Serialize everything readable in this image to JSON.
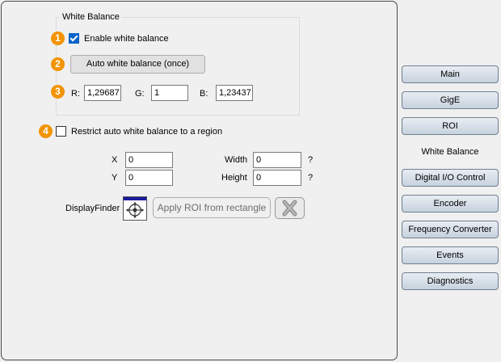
{
  "group": {
    "title": "White Balance"
  },
  "markers": [
    "1",
    "2",
    "3",
    "4"
  ],
  "enable_wb": {
    "label": "Enable white balance",
    "checked": true
  },
  "auto_wb": {
    "label": "Auto white balance (once)"
  },
  "rgb": {
    "r_label": "R:",
    "r_value": "1,29687",
    "g_label": "G:",
    "g_value": "1",
    "b_label": "B:",
    "b_value": "1,23437"
  },
  "restrict": {
    "label": "Restrict auto white balance to a region",
    "checked": false
  },
  "roi": {
    "x_label": "X",
    "x_value": "0",
    "y_label": "Y",
    "y_value": "0",
    "width_label": "Width",
    "width_value": "0",
    "width_help": "?",
    "height_label": "Height",
    "height_value": "0",
    "height_help": "?"
  },
  "display_finder": {
    "label": "DisplayFinder",
    "icon": "crosshair-target-icon",
    "apply_label": "Apply ROI from rectangle",
    "clear_icon": "close-x-icon"
  },
  "nav": {
    "items": [
      "Main",
      "GigE",
      "ROI",
      "White Balance",
      "Digital I/O Control",
      "Encoder",
      "Frequency Converter",
      "Events",
      "Diagnostics"
    ],
    "active": "White Balance"
  },
  "colors": {
    "marker": "#f29400",
    "checkbox": "#0a64c8",
    "nav_gradient_top": "#e8edf3",
    "nav_gradient_bottom": "#c7d2de"
  }
}
